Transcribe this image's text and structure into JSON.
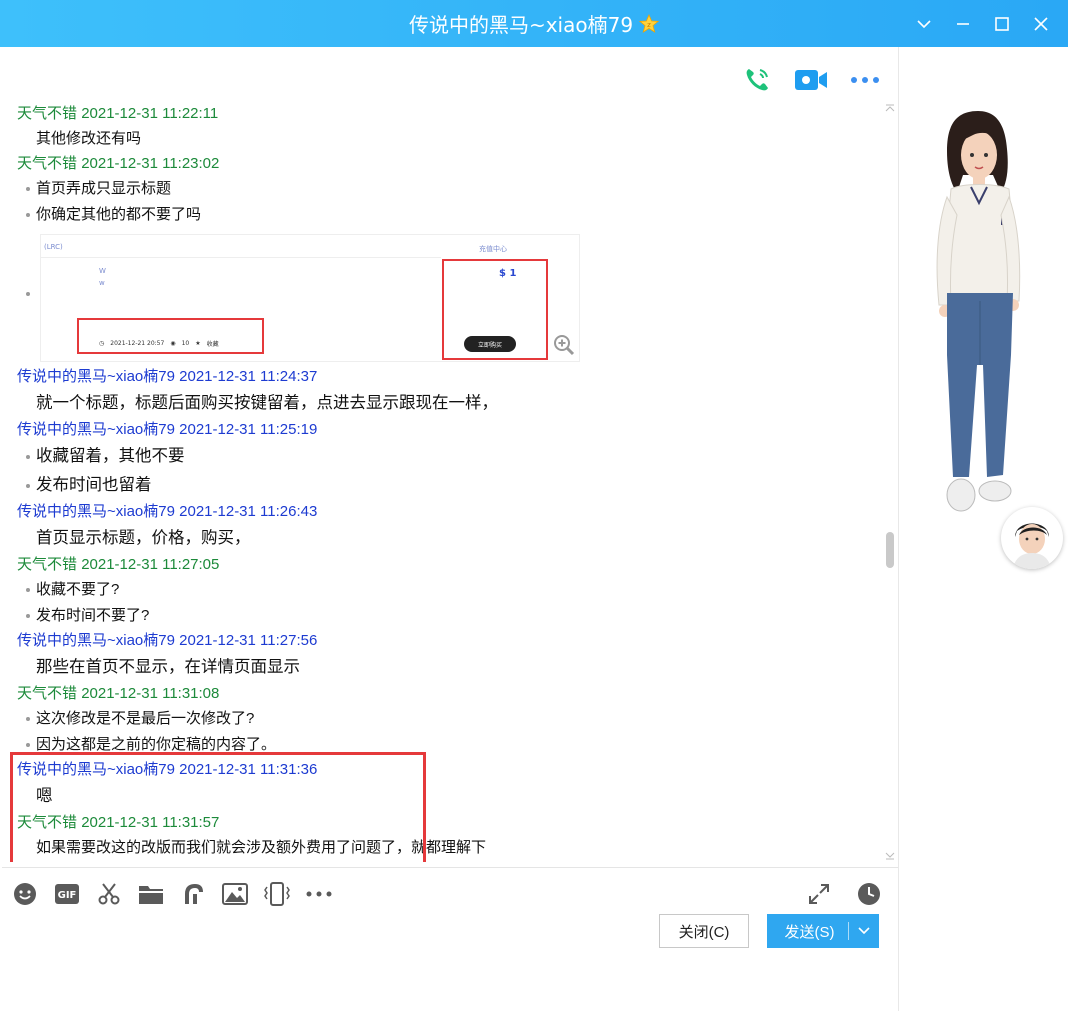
{
  "window": {
    "title": "传说中的黑马~xiao楠79"
  },
  "messages": {
    "items": [
      {
        "sender": "天气不错",
        "time": "2021-12-31 11:22:11",
        "color": "green",
        "lines": [
          "其他修改还有吗"
        ],
        "bullets": false,
        "big": false
      },
      {
        "sender": "天气不错",
        "time": "2021-12-31 11:23:02",
        "color": "green",
        "lines": [
          "首页弄成只显示标题",
          "你确定其他的都不要了吗"
        ],
        "bullets": true,
        "big": false
      }
    ],
    "image_preview": {
      "lrc_label": "(LRC)",
      "center_label": "充值中心",
      "w1": "W",
      "w2": "w",
      "price": "$ 1",
      "meta_date": "2021-12-21 20:57",
      "meta_views": "10",
      "meta_fav": "收藏",
      "buy_label": "立即购买"
    },
    "items2": [
      {
        "sender": "传说中的黑马~xiao楠79",
        "time": "2021-12-31 11:24:37",
        "color": "blue",
        "lines": [
          "就一个标题，标题后面购买按键留着，点进去显示跟现在一样，"
        ],
        "bullets": false,
        "big": true
      },
      {
        "sender": "传说中的黑马~xiao楠79",
        "time": "2021-12-31 11:25:19",
        "color": "blue",
        "lines": [
          "收藏留着，其他不要",
          "发布时间也留着"
        ],
        "bullets": true,
        "big": true
      },
      {
        "sender": "传说中的黑马~xiao楠79",
        "time": "2021-12-31 11:26:43",
        "color": "blue",
        "lines": [
          "首页显示标题，价格，购买，"
        ],
        "bullets": false,
        "big": true
      },
      {
        "sender": "天气不错",
        "time": "2021-12-31 11:27:05",
        "color": "green",
        "lines": [
          "收藏不要了?",
          "发布时间不要了?"
        ],
        "bullets": true,
        "big": false
      },
      {
        "sender": "传说中的黑马~xiao楠79",
        "time": "2021-12-31 11:27:56",
        "color": "blue",
        "lines": [
          "那些在首页不显示，在详情页面显示"
        ],
        "bullets": false,
        "big": true
      },
      {
        "sender": "天气不错",
        "time": "2021-12-31 11:31:08",
        "color": "green",
        "lines": [
          "这次修改是不是最后一次修改了?",
          "因为这都是之前的你定稿的内容了。"
        ],
        "bullets": true,
        "big": false
      },
      {
        "sender": "传说中的黑马~xiao楠79",
        "time": "2021-12-31 11:31:36",
        "color": "blue",
        "lines": [
          "嗯"
        ],
        "bullets": false,
        "big": true
      },
      {
        "sender": "天气不错",
        "time": "2021-12-31 11:31:57",
        "color": "green",
        "lines": [
          "如果需要改这的改版而我们就会涉及额外费用了问题了，就都理解下"
        ],
        "bullets": false,
        "big": false
      }
    ]
  },
  "toolbar": {
    "icons": [
      "emoji-icon",
      "gif-icon",
      "scissors-icon",
      "folder-icon",
      "music-icon",
      "image-icon",
      "shake-icon",
      "more-icon"
    ],
    "gif_label": "GIF"
  },
  "buttons": {
    "close_label": "关闭(C)",
    "send_label": "发送(S)"
  },
  "colors": {
    "titlebar": "#2aa8f5",
    "green_sender": "#1c8a3a",
    "blue_sender": "#1d3bd1",
    "highlight": "#e5393b",
    "send_button": "#2fa7f0"
  }
}
